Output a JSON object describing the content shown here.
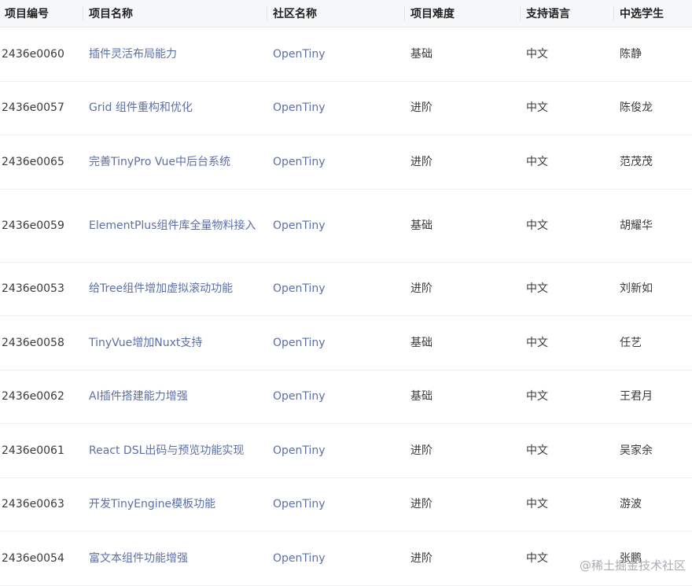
{
  "table": {
    "headers": [
      "项目编号",
      "项目名称",
      "社区名称",
      "项目难度",
      "支持语言",
      "中选学生"
    ],
    "rows": [
      {
        "id": "2436e0060",
        "name": "插件灵活布局能力",
        "community": "OpenTiny",
        "difficulty": "基础",
        "language": "中文",
        "student": "陈静"
      },
      {
        "id": "2436e0057",
        "name": "Grid 组件重构和优化",
        "community": "OpenTiny",
        "difficulty": "进阶",
        "language": "中文",
        "student": "陈俊龙"
      },
      {
        "id": "2436e0065",
        "name": "完善TinyPro Vue中后台系统",
        "community": "OpenTiny",
        "difficulty": "进阶",
        "language": "中文",
        "student": "范茂茂"
      },
      {
        "id": "2436e0059",
        "name": "ElementPlus组件库全量物料接入",
        "community": "OpenTiny",
        "difficulty": "基础",
        "language": "中文",
        "student": "胡耀华"
      },
      {
        "id": "2436e0053",
        "name": "给Tree组件增加虚拟滚动功能",
        "community": "OpenTiny",
        "difficulty": "进阶",
        "language": "中文",
        "student": "刘新如"
      },
      {
        "id": "2436e0058",
        "name": "TinyVue增加Nuxt支持",
        "community": "OpenTiny",
        "difficulty": "基础",
        "language": "中文",
        "student": "任艺"
      },
      {
        "id": "2436e0062",
        "name": "AI插件搭建能力增强",
        "community": "OpenTiny",
        "difficulty": "基础",
        "language": "中文",
        "student": "王君月"
      },
      {
        "id": "2436e0061",
        "name": "React DSL出码与预览功能实现",
        "community": "OpenTiny",
        "difficulty": "进阶",
        "language": "中文",
        "student": "吴家余"
      },
      {
        "id": "2436e0063",
        "name": "开发TinyEngine模板功能",
        "community": "OpenTiny",
        "difficulty": "进阶",
        "language": "中文",
        "student": "游波"
      },
      {
        "id": "2436e0054",
        "name": "富文本组件功能增强",
        "community": "OpenTiny",
        "difficulty": "进阶",
        "language": "中文",
        "student": "张鹏"
      }
    ]
  },
  "watermark": "@稀土掘金技术社区",
  "colors": {
    "header_bg": "#f6f7f9",
    "link": "#5c6fa8",
    "text": "#3a3a3a",
    "row_border": "#eef0f3"
  }
}
